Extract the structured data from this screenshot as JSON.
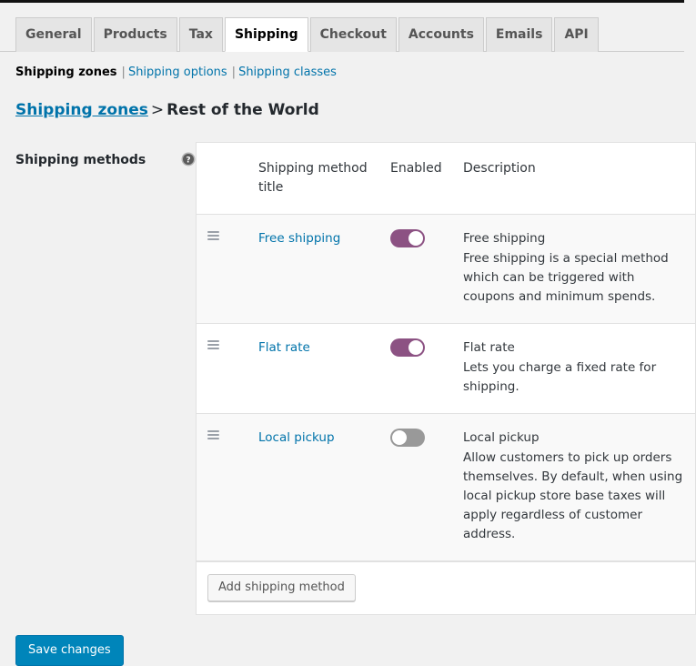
{
  "tabs": [
    {
      "label": "General",
      "active": false
    },
    {
      "label": "Products",
      "active": false
    },
    {
      "label": "Tax",
      "active": false
    },
    {
      "label": "Shipping",
      "active": true
    },
    {
      "label": "Checkout",
      "active": false
    },
    {
      "label": "Accounts",
      "active": false
    },
    {
      "label": "Emails",
      "active": false
    },
    {
      "label": "API",
      "active": false
    }
  ],
  "subnav": {
    "items": [
      {
        "label": "Shipping zones",
        "current": true
      },
      {
        "label": "Shipping options",
        "current": false
      },
      {
        "label": "Shipping classes",
        "current": false
      }
    ],
    "separator": "|"
  },
  "breadcrumb": {
    "link": "Shipping zones",
    "separator": ">",
    "current": "Rest of the World"
  },
  "settings_row": {
    "label": "Shipping methods",
    "help_icon": "help-question-icon"
  },
  "table": {
    "columns": {
      "sort": "",
      "title": "Shipping method title",
      "enabled": "Enabled",
      "description": "Description"
    },
    "rows": [
      {
        "handle_icon": "drag-handle-icon",
        "title": "Free shipping",
        "enabled": true,
        "toggle_state": "on",
        "desc_title": "Free shipping",
        "desc_text": "Free shipping is a special method which can be triggered with coupons and minimum spends."
      },
      {
        "handle_icon": "drag-handle-icon",
        "title": "Flat rate",
        "enabled": true,
        "toggle_state": "on",
        "desc_title": "Flat rate",
        "desc_text": "Lets you charge a fixed rate for shipping."
      },
      {
        "handle_icon": "drag-handle-icon",
        "title": "Local pickup",
        "enabled": false,
        "toggle_state": "off",
        "desc_title": "Local pickup",
        "desc_text": "Allow customers to pick up orders themselves. By default, when using local pickup store base taxes will apply regardless of customer address."
      }
    ],
    "footer_button": "Add shipping method"
  },
  "save_button": "Save changes",
  "colors": {
    "page_background": "#f1f1f1",
    "link": "#0073aa",
    "toggle_on": "#8c5283",
    "toggle_off": "#999999",
    "primary_button": "#0085ba",
    "row_alt_background": "#f9f9f9",
    "border": "#e1e1e1",
    "admin_bar": "#111111"
  }
}
